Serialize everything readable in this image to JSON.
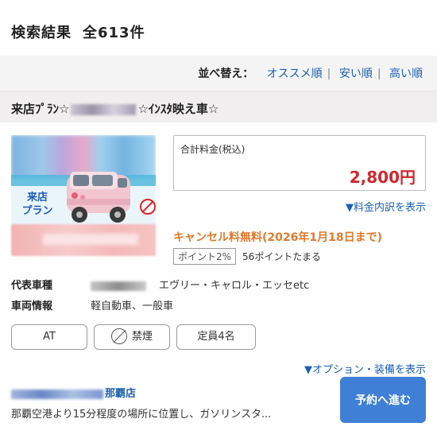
{
  "header": {
    "title": "検索結果",
    "count": "全613件"
  },
  "sort": {
    "label": "並べ替え：",
    "options": [
      "オススメ順",
      "安い順",
      "高い順"
    ],
    "separator": "|"
  },
  "plan": {
    "title_prefix": "来店ﾌﾟﾗﾝ☆",
    "title_suffix": "☆ｲﾝｽﾀ映え車☆"
  },
  "thumbnail": {
    "badge": "来店\nプラン"
  },
  "price": {
    "label": "合計料金(税込)",
    "value": "2,800円",
    "breakdown_link": "▼料金内訳を表示"
  },
  "cancel": {
    "text": "キャンセル料無料(2026年1月18日まで)"
  },
  "points": {
    "badge": "ポイント2%",
    "text": "56ポイントたまる"
  },
  "specs": {
    "model_key": "代表車種",
    "model_val": "エヴリー・キャロル・エッセetc",
    "info_key": "車両情報",
    "info_val": "軽自動車、一般車"
  },
  "chips": {
    "transmission": "AT",
    "smoking": "禁煙",
    "capacity": "定員4名"
  },
  "options_link": "▼オプション・装備を表示",
  "store": {
    "name_suffix": "那覇店",
    "description": "那覇空港より15分程度の場所に位置し、ガソリンスタ..."
  },
  "reserve_button": "予約へ進む",
  "colors": {
    "price": "#d0282e",
    "link": "#1a5fb4",
    "cancel": "#e07a2a",
    "button": "#3f7fd6"
  }
}
